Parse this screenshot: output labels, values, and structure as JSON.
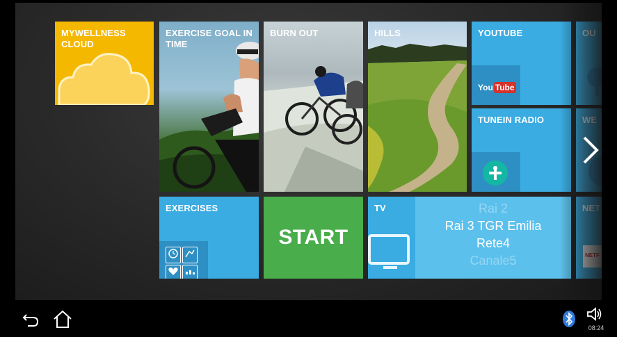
{
  "tiles": {
    "mywellness": {
      "title": "MYWELLNESS CLOUD",
      "color": "#f5b800"
    },
    "exercise_goal": {
      "title": "EXERCISE GOAL IN TIME"
    },
    "burn_out": {
      "title": "BURN OUT"
    },
    "hills": {
      "title": "HILLS"
    },
    "youtube": {
      "title": "YOUTUBE",
      "logo_you": "You",
      "logo_tube": "Tube"
    },
    "tunein": {
      "title": "TUNEIN RADIO"
    },
    "out": {
      "title": "OU"
    },
    "we": {
      "title": "WE"
    },
    "exercises": {
      "title": "EXERCISES"
    },
    "start": {
      "label": "START",
      "color": "#48ad4a"
    },
    "tv": {
      "title": "TV",
      "channels": [
        "Rai 2",
        "Rai 3 TGR Emilia",
        "Rete4",
        "Canale5"
      ],
      "selected_channel": "Rai 3 TGR Emilia"
    },
    "net": {
      "title": "NET",
      "logo": "NETF"
    }
  },
  "status_bar": {
    "time": "08:24"
  },
  "colors": {
    "tile_blue": "#3aace2",
    "tile_blue_dark": "#2e8fc4",
    "accent_red": "#d6312b",
    "tunein_teal": "#14b7a4"
  }
}
